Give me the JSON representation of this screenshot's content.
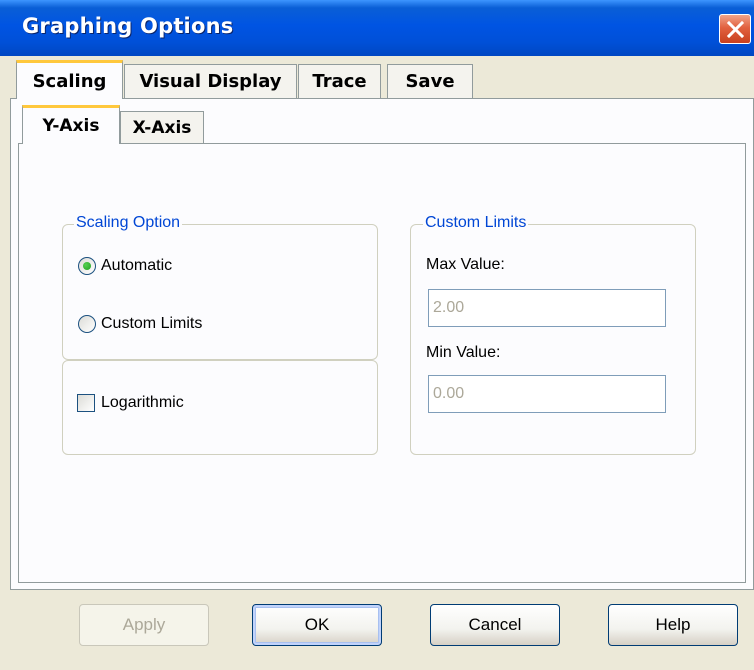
{
  "window": {
    "title": "Graphing Options"
  },
  "tabs": [
    "Scaling",
    "Visual Display",
    "Trace",
    "Save"
  ],
  "inner_tabs": [
    "Y-Axis",
    "X-Axis"
  ],
  "scaling_option": {
    "legend": "Scaling Option",
    "options": [
      "Automatic",
      "Custom Limits"
    ],
    "selected": "Automatic",
    "logarithmic_label": "Logarithmic",
    "logarithmic_checked": false
  },
  "custom_limits": {
    "legend": "Custom Limits",
    "max_label": "Max Value:",
    "max_value": "2.00",
    "min_label": "Min Value:",
    "min_value": "0.00"
  },
  "buttons": {
    "apply": "Apply",
    "ok": "OK",
    "cancel": "Cancel",
    "help": "Help"
  },
  "colors": {
    "title_bar": "#0054e3",
    "legend_text": "#0046d5",
    "active_tab_accent": "#ffc83c"
  }
}
